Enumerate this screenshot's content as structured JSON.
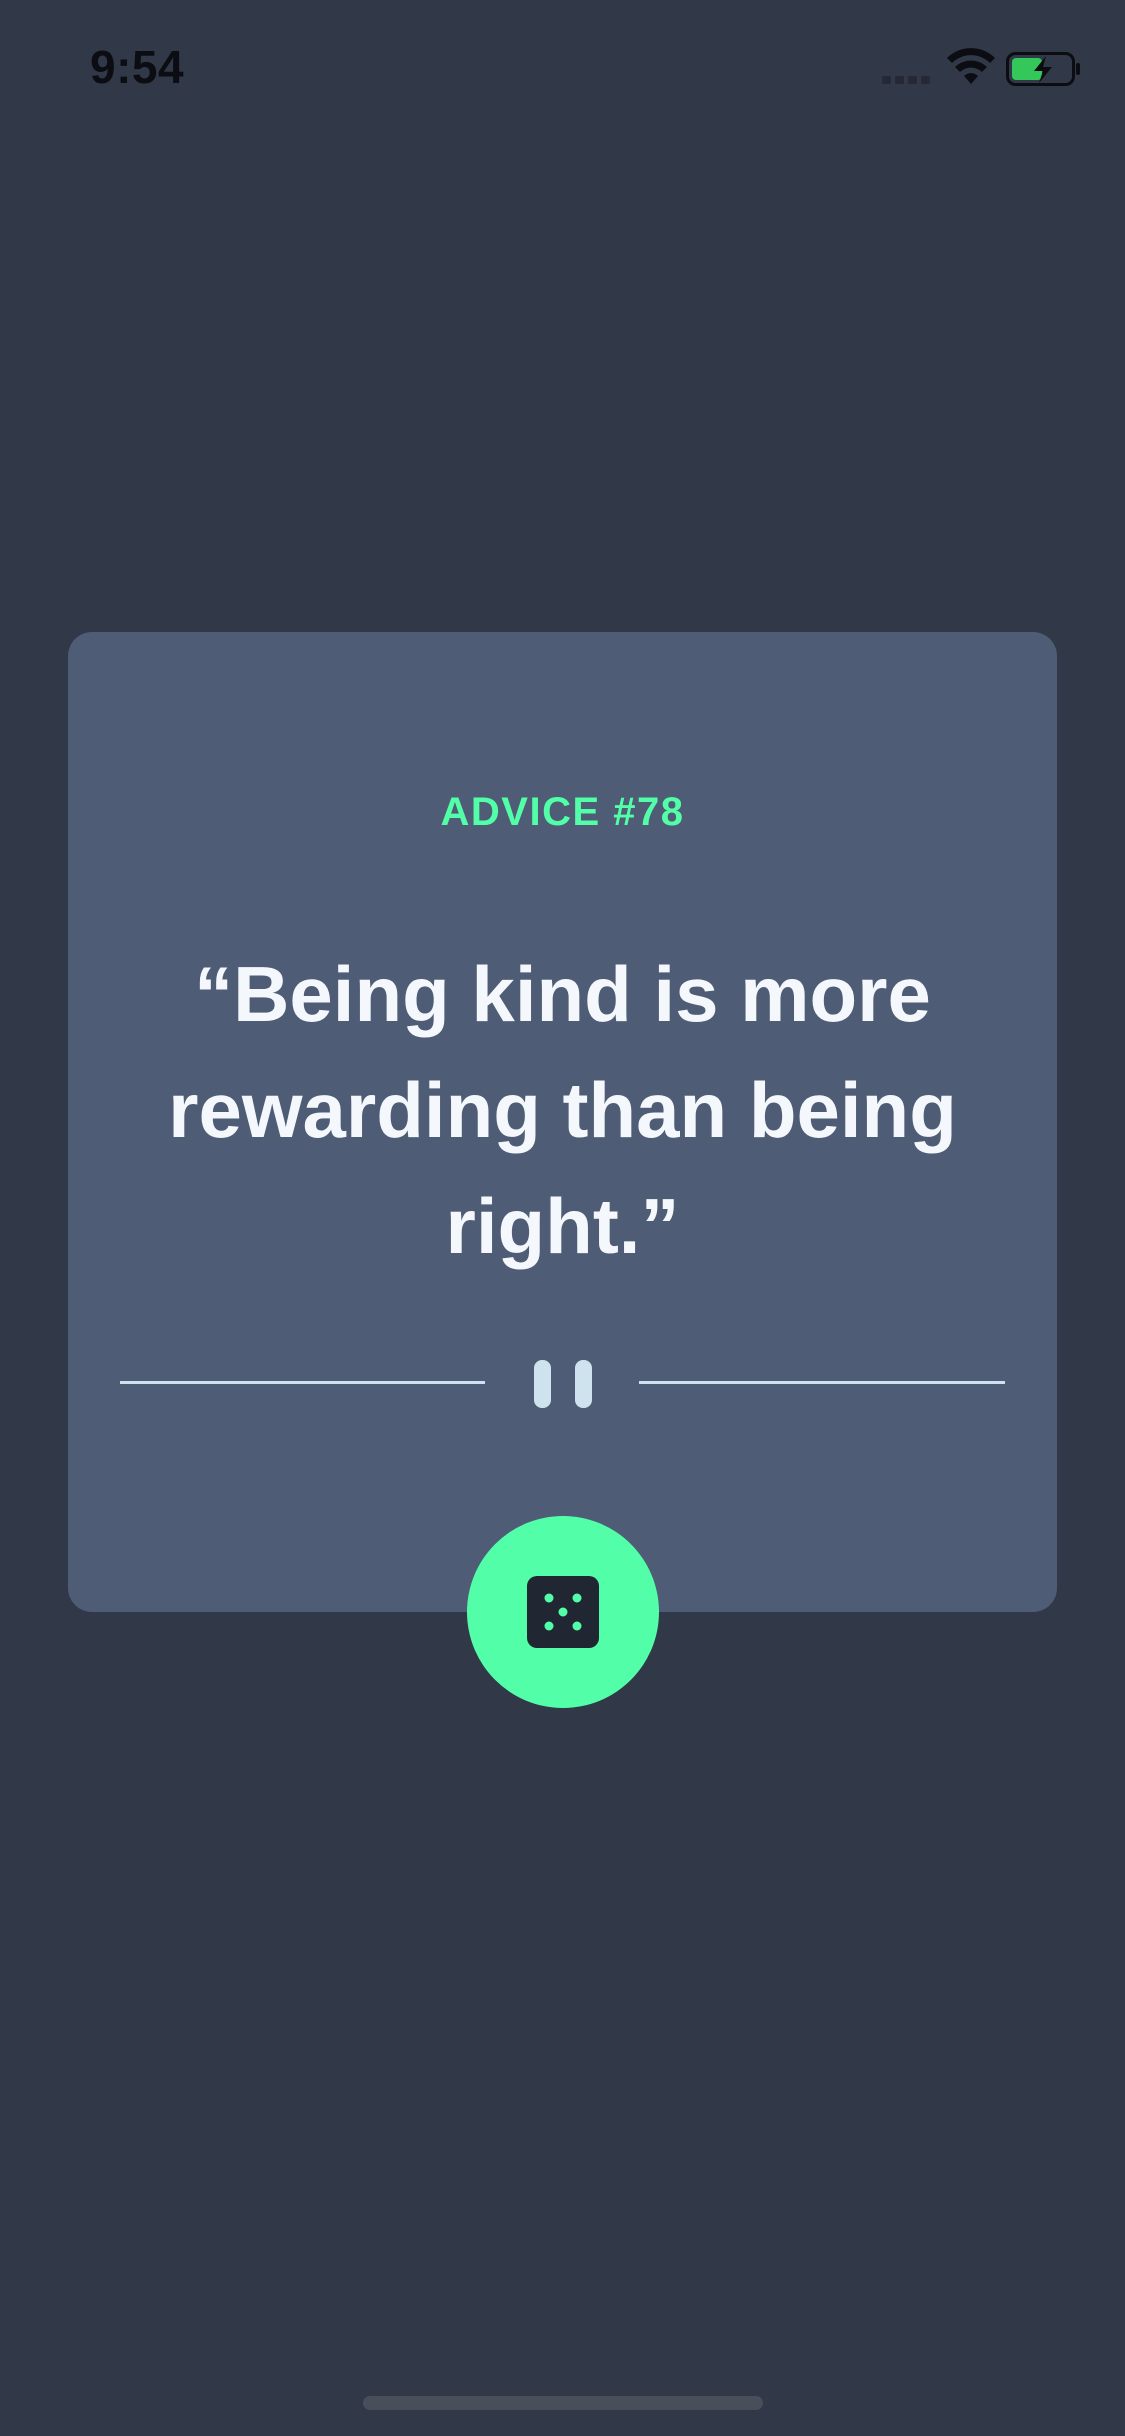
{
  "status_bar": {
    "time": "9:54",
    "icons": [
      "cellular-signal-icon",
      "wifi-icon",
      "battery-charging-icon"
    ]
  },
  "card": {
    "advice_label": "ADVICE #78",
    "advice_text": "“Being kind is more rewarding than being right.”",
    "divider_icon": "pause-icon"
  },
  "dice_button": {
    "icon": "dice-icon"
  },
  "colors": {
    "background": "#313847",
    "card": "#4e5d75",
    "accent": "#52ffa8",
    "text": "#f4f7fb",
    "divider": "#cfe3ee"
  }
}
